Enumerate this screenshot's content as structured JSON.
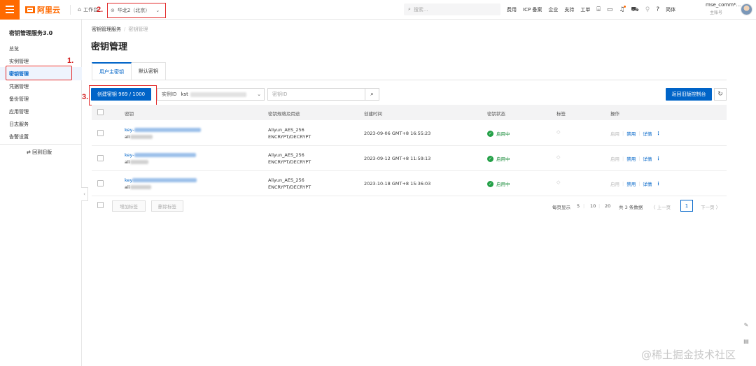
{
  "colors": {
    "brand": "#ff6a00",
    "primary": "#0064c8",
    "annotation": "#e32b2b",
    "success": "#23a047"
  },
  "topbar": {
    "logo": "阿里云",
    "workbench": "工作台",
    "region": "华北2（北京）",
    "search_placeholder": "搜索...",
    "nav": [
      "费用",
      "ICP 备案",
      "企业",
      "支持",
      "工单"
    ],
    "lang": "简体",
    "user_name": "mse_comm*...",
    "user_role": "主账号"
  },
  "annotations": {
    "a1": "1.",
    "a2": "2.",
    "a3": "3."
  },
  "sidebar": {
    "title": "密钥管理服务3.0",
    "items": [
      {
        "label": "总览"
      },
      {
        "label": "实例管理"
      },
      {
        "label": "密钥管理"
      },
      {
        "label": "凭据管理"
      },
      {
        "label": "备份管理"
      },
      {
        "label": "应用管理"
      },
      {
        "label": "日志服务"
      },
      {
        "label": "告警设置"
      }
    ],
    "back_label": "回到旧版"
  },
  "breadcrumb": {
    "root": "密钥管理服务",
    "current": "密钥管理"
  },
  "page_title": "密钥管理",
  "tabs": [
    "用户主密钥",
    "默认密钥"
  ],
  "toolbar": {
    "create_label": "创建密钥  969 / 1000",
    "instance_label": "实例ID",
    "instance_value": "kst",
    "key_placeholder": "密钥ID",
    "old_console_label": "返回旧版控制台"
  },
  "table": {
    "headers": [
      "密钥",
      "密钥规格及用途",
      "创建时间",
      "密钥状态",
      "标签",
      "操作"
    ],
    "rows": [
      {
        "key_prefix": "key-",
        "alias_prefix": "ali",
        "spec": "Aliyun_AES_256",
        "usage": "ENCRYPT/DECRYPT",
        "created": "2023-09-06 GMT+8 16:55:23",
        "status": "启用中"
      },
      {
        "key_prefix": "key-",
        "alias_prefix": "ali",
        "spec": "Aliyun_AES_256",
        "usage": "ENCRYPT/DECRYPT",
        "created": "2023-09-12 GMT+8 11:59:13",
        "status": "启用中"
      },
      {
        "key_prefix": "key",
        "alias_prefix": "ali",
        "spec": "Aliyun_AES_256",
        "usage": "ENCRYPT/DECRYPT",
        "created": "2023-10-18 GMT+8 15:36:03",
        "status": "启用中"
      }
    ],
    "ops": {
      "enable": "启用",
      "disable": "禁用",
      "detail": "详情",
      "more": "⋮"
    }
  },
  "footer": {
    "add_tag": "增加标签",
    "remove_tag": "删除标签",
    "page_size_label": "每页显示",
    "page_sizes": [
      "5",
      "10",
      "20"
    ],
    "total": "共 3 条数据",
    "prev": "〈 上一页",
    "page": "1",
    "next": "下一页 〉"
  },
  "watermark": "@稀土掘金技术社区"
}
